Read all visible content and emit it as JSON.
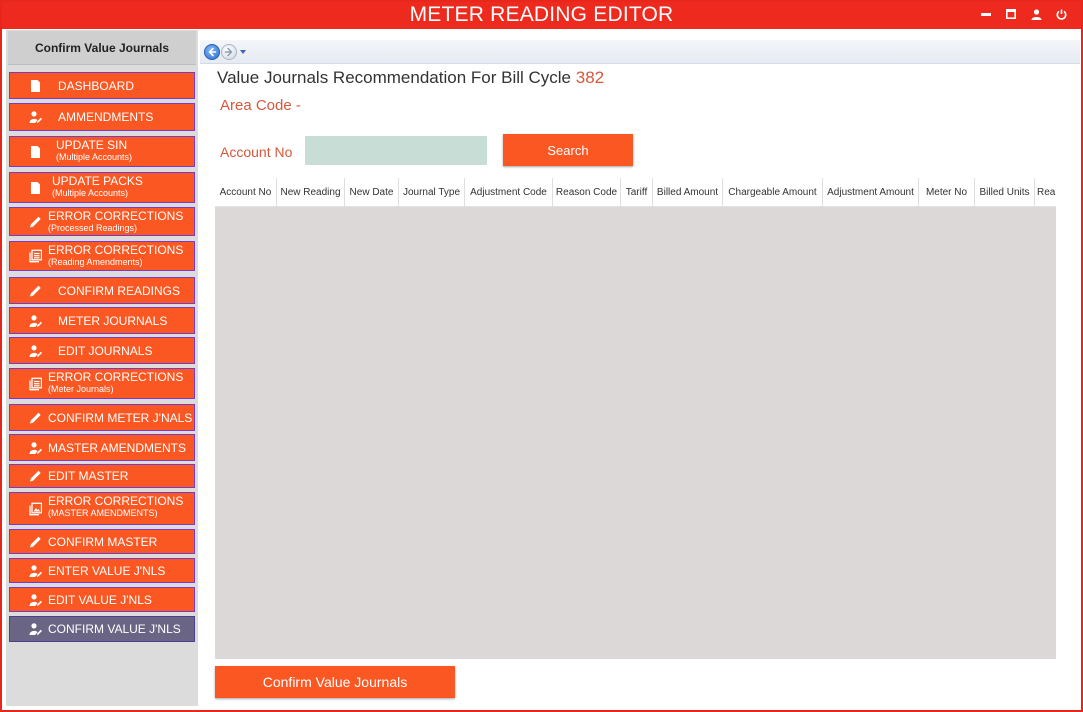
{
  "app": {
    "title": "METER READING EDITOR"
  },
  "window_controls": {
    "minimize_icon": "minimize-icon",
    "maximize_icon": "maximize-icon",
    "user_icon": "user-icon",
    "power_icon": "power-icon"
  },
  "colors": {
    "accent": "#fb5722",
    "title_bar": "#ee2a1e",
    "active_nav": "#6a6585",
    "highlight_text": "#d9573a",
    "grid_bg": "#ddd8d8",
    "input_bg": "#c8ddd6"
  },
  "sidebar": {
    "header": "Confirm Value Journals",
    "items": [
      {
        "label": "DASHBOARD",
        "sub": "",
        "icon": "document-icon"
      },
      {
        "label": "AMMENDMENTS",
        "sub": "",
        "icon": "user-edit-icon"
      },
      {
        "label": "UPDATE SIN",
        "sub": "(Multiple Accounts)",
        "icon": "document-icon"
      },
      {
        "label": "UPDATE PACKS",
        "sub": "(Multiple Accounts)",
        "icon": "document-icon"
      },
      {
        "label": "ERROR CORRECTIONS",
        "sub": "(Processed Readings)",
        "icon": "pencil-icon"
      },
      {
        "label": "ERROR CORRECTIONS",
        "sub": "(Reading Amendments)",
        "icon": "list-icon"
      },
      {
        "label": "CONFIRM READINGS",
        "sub": "",
        "icon": "pencil-icon"
      },
      {
        "label": "METER JOURNALS",
        "sub": "",
        "icon": "user-edit-icon"
      },
      {
        "label": "EDIT JOURNALS",
        "sub": "",
        "icon": "user-edit-icon"
      },
      {
        "label": "ERROR CORRECTIONS",
        "sub": "(Meter Journals)",
        "icon": "list-icon"
      },
      {
        "label": "CONFIRM METER J'NALS",
        "sub": "",
        "icon": "pencil-icon"
      },
      {
        "label": "MASTER AMENDMENTS",
        "sub": "",
        "icon": "user-edit-icon"
      },
      {
        "label": "EDIT MASTER",
        "sub": "",
        "icon": "pencil-icon"
      },
      {
        "label": "ERROR CORRECTIONS",
        "sub": "(MASTER AMENDMENTS)",
        "icon": "image-list-icon"
      },
      {
        "label": "CONFIRM MASTER",
        "sub": "",
        "icon": "pencil-icon"
      },
      {
        "label": "ENTER VALUE J'NLS",
        "sub": "",
        "icon": "user-edit-icon"
      },
      {
        "label": "EDIT VALUE J'NLS",
        "sub": "",
        "icon": "user-edit-icon"
      },
      {
        "label": "CONFIRM VALUE J'NLS",
        "sub": "",
        "icon": "user-edit-icon",
        "active": true
      }
    ]
  },
  "main": {
    "title_prefix": "Value Journals Recommendation For Bill Cycle",
    "bill_cycle": "382",
    "area_code": "Area Code -",
    "search": {
      "label": "Account No",
      "value": "",
      "placeholder": "",
      "button": "Search"
    },
    "grid": {
      "columns": [
        "Account No",
        "New Reading",
        "New Date",
        "Journal Type",
        "Adjustment Code",
        "Reason Code",
        "Tariff",
        "Billed Amount",
        "Chargeable Amount",
        "Adjustment Amount",
        "Meter No",
        "Billed Units",
        "Rea"
      ],
      "rows": []
    },
    "confirm_button": "Confirm Value Journals"
  }
}
